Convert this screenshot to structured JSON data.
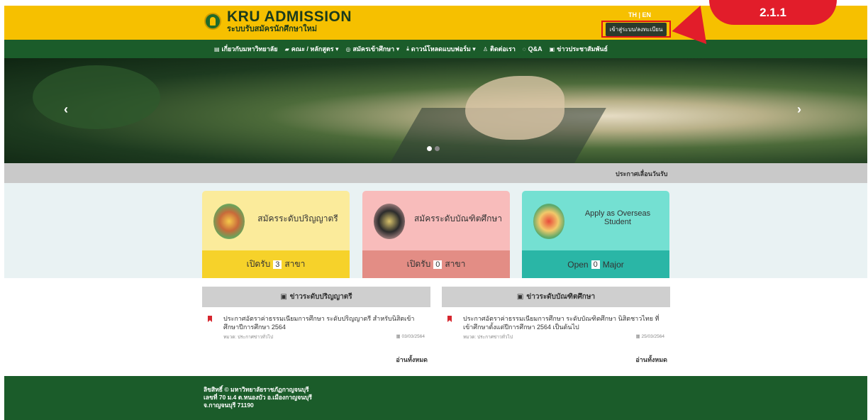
{
  "header": {
    "brand_title": "KRU ADMISSION",
    "brand_subtitle": "ระบบรับสมัครนักศึกษาใหม่",
    "lang": "TH | EN",
    "login_label": "เข้าสู่ระบบ/ลงทะเบียน",
    "callout_label": "2.1.1"
  },
  "nav": {
    "items": [
      {
        "icon": "list-icon",
        "label": "เกี่ยวกับมหาวิทยาลัย"
      },
      {
        "icon": "book-icon",
        "label": "คณะ / หลักสูตร ▾"
      },
      {
        "icon": "apply-icon",
        "label": "สมัครเข้าศึกษา ▾"
      },
      {
        "icon": "download-icon",
        "label": "ดาวน์โหลดแบบฟอร์ม ▾"
      },
      {
        "icon": "contact-icon",
        "label": "ติดต่อเรา"
      },
      {
        "icon": "qa-icon",
        "label": "Q&A"
      },
      {
        "icon": "news-icon",
        "label": "ข่าวประชาสัมพันธ์"
      }
    ]
  },
  "hero": {
    "prev": "‹",
    "next": "›"
  },
  "marquee": {
    "text": "ประกาศเลื่อนวันรับ"
  },
  "cards": [
    {
      "title": "สมัครระดับปริญญาตรี",
      "prefix": "เปิดรับ",
      "count": "3",
      "suffix": "สาขา"
    },
    {
      "title": "สมัครระดับบัณฑิตศึกษา",
      "prefix": "เปิดรับ",
      "count": "0",
      "suffix": "สาขา"
    },
    {
      "title": "Apply as Overseas Student",
      "prefix": "Open",
      "count": "0",
      "suffix": "Major"
    }
  ],
  "news": [
    {
      "heading": "ข่าวระดับปริญญาตรี",
      "title": "ประกาศอัตราค่าธรรมเนียมการศึกษา ระดับปริญญาตรี สำหรับนิสิตเข้าศึกษาปีการศึกษา 2564",
      "category": "หมวด: ประกาศข่าวทั่วไป",
      "date": "03/03/2564",
      "read_all": "อ่านทั้งหมด"
    },
    {
      "heading": "ข่าวระดับบัณฑิตศึกษา",
      "title": "ประกาศอัตราค่าธรรมเนียมการศึกษา ระดับบัณฑิตศึกษา นิสิตชาวไทย ที่เข้าศึกษาตั้งแต่ปีการศึกษา 2564 เป็นต้นไป",
      "category": "หมวด: ประกาศข่าวทั่วไป",
      "date": "25/03/2564",
      "read_all": "อ่านทั้งหมด"
    }
  ],
  "footer": {
    "line1": "ลิขสิทธิ์ © มหาวิทยาลัยราชภัฏกาญจนบุรี",
    "line2": "เลขที่ 70 ม.4 ต.หนองบัว อ.เมืองกาญจนบุรี",
    "line3": "จ.กาญจนบุรี 71190"
  },
  "colors": {
    "header_yellow": "#f6c000",
    "nav_green": "#1b5c2a",
    "callout_red": "#e21d2a"
  }
}
